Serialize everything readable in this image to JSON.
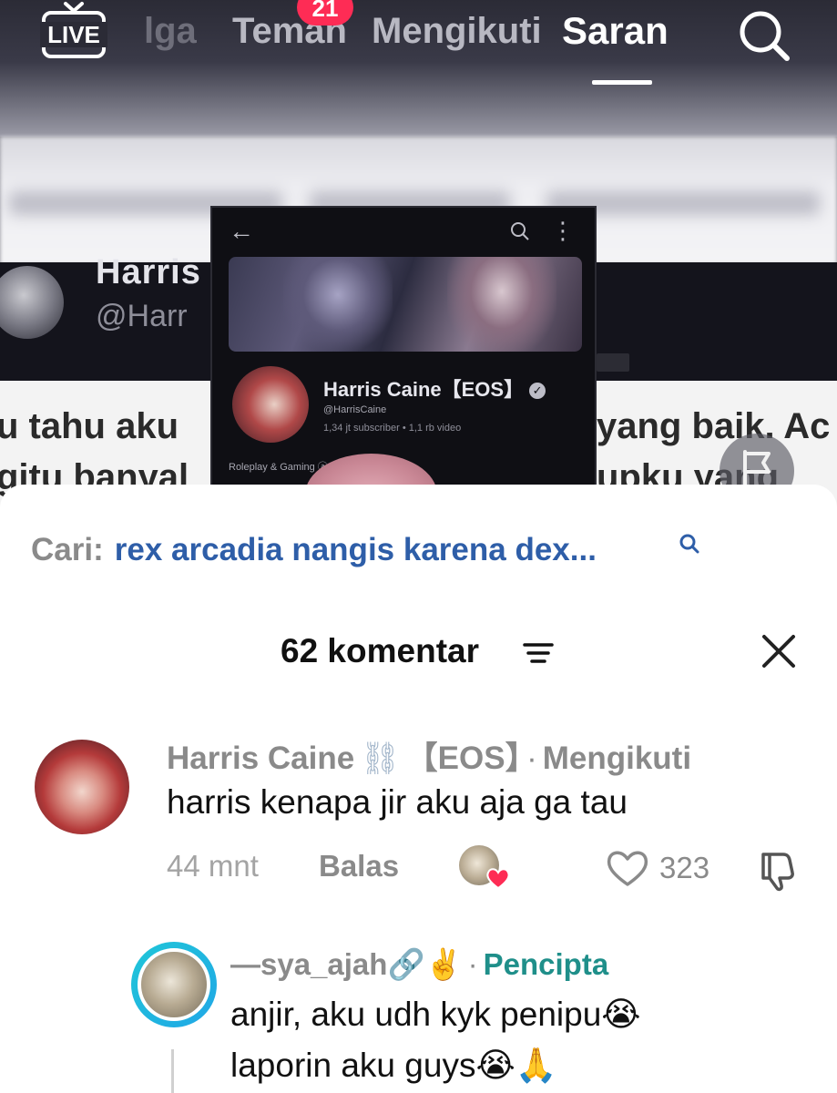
{
  "nav": {
    "live_label": "LIVE",
    "tabs": [
      {
        "label": "lga",
        "active": false
      },
      {
        "label": "Teman",
        "active": false,
        "badge": "21"
      },
      {
        "label": "Mengikuti",
        "active": false
      },
      {
        "label": "Saran",
        "active": true
      }
    ],
    "icons": {
      "live": "live-tv-icon",
      "search": "search-icon"
    }
  },
  "video": {
    "bg_handle_name": "Harris",
    "bg_handle": "@Harr",
    "bg_text_left_1": "u tahu aku",
    "bg_text_left_2": "gitu banyal",
    "bg_text_right_1": "yang baik. Ac",
    "bg_text_right_2": "upku yang",
    "phone": {
      "channel_name": "Harris Caine【EOS】",
      "handle": "@HarrisCaine",
      "stats": "1,34 jt subscriber • 1,1 rb video",
      "category": "Roleplay & Gaming ⓐ"
    }
  },
  "sheet": {
    "search_label": "Cari:",
    "search_query": "rex arcadia nangis karena dex...",
    "comment_count_title": "62 komentar",
    "comments": [
      {
        "author": "Harris Caine",
        "author_emoji": "⛓",
        "author_tag": "【EOS】",
        "relation": "Mengikuti",
        "text": "harris kenapa jir aku aja ga tau",
        "time": "44 mnt",
        "reply_label": "Balas",
        "likes": "323"
      }
    ],
    "reply": {
      "author": "—sya_ajah",
      "author_emoji": "🔗✌️",
      "role": "Pencipta",
      "line1": "anjir, aku udh kyk penipu😭",
      "line2": "laporin aku guys😭🙏"
    }
  },
  "colors": {
    "badge": "#fe2c55",
    "search_query": "#2e5ea8",
    "creator_tag": "#1f8f8a",
    "heart": "#fe2c55",
    "avatar_ring": "#21a7e6"
  }
}
